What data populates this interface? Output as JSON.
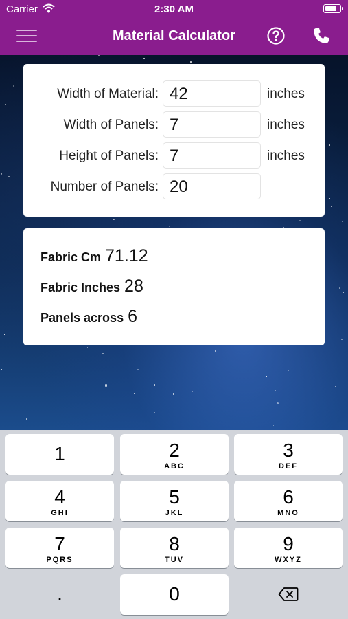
{
  "status_bar": {
    "carrier": "Carrier",
    "time": "2:30 AM",
    "battery_level": 0.85
  },
  "nav": {
    "title": "Material Calculator",
    "icons": [
      "hamburger-menu-icon",
      "help-circle-icon",
      "phone-icon"
    ]
  },
  "inputs": [
    {
      "label": "Width of Material:",
      "value": "42",
      "unit": "inches"
    },
    {
      "label": "Width of Panels:",
      "value": "7",
      "unit": "inches"
    },
    {
      "label": "Height of Panels:",
      "value": "7",
      "unit": "inches"
    },
    {
      "label": "Number of Panels:",
      "value": "20",
      "unit": ""
    }
  ],
  "results": [
    {
      "label": "Fabric Cm",
      "value": "71.12"
    },
    {
      "label": "Fabric Inches",
      "value": "28"
    },
    {
      "label": "Panels across",
      "value": "6"
    }
  ],
  "keypad": {
    "keys": [
      {
        "digit": "1",
        "letters": ""
      },
      {
        "digit": "2",
        "letters": "ABC"
      },
      {
        "digit": "3",
        "letters": "DEF"
      },
      {
        "digit": "4",
        "letters": "GHI"
      },
      {
        "digit": "5",
        "letters": "JKL"
      },
      {
        "digit": "6",
        "letters": "MNO"
      },
      {
        "digit": "7",
        "letters": "PQRS"
      },
      {
        "digit": "8",
        "letters": "TUV"
      },
      {
        "digit": "9",
        "letters": "WXYZ"
      },
      {
        "digit": "0",
        "letters": ""
      }
    ],
    "decimal": ".",
    "delete_icon": "backspace-icon"
  },
  "colors": {
    "nav_bar": "#8a1d8e",
    "keypad_bg": "#d1d4da"
  }
}
